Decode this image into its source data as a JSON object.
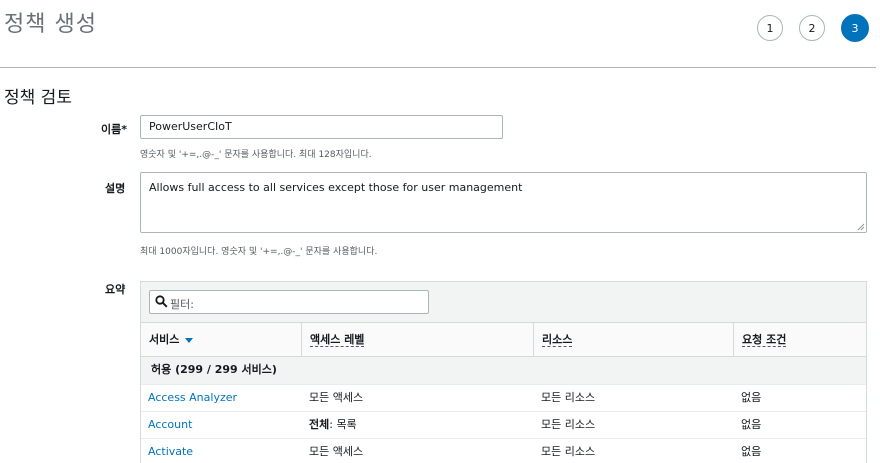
{
  "header": {
    "title": "정책 생성"
  },
  "wizard": {
    "steps": [
      "1",
      "2",
      "3"
    ],
    "current_step": 3
  },
  "section": {
    "title": "정책 검토"
  },
  "form": {
    "name": {
      "label": "이름*",
      "value": "PowerUserCIoT",
      "hint": "영숫자 및 '+=,.@-_' 문자를 사용합니다. 최대 128자입니다."
    },
    "description": {
      "label": "설명",
      "value": "Allows full access to all services except those for user management",
      "hint": "최대 1000자입니다. 영숫자 및 '+=,.@-_' 문자를 사용합니다."
    }
  },
  "summary": {
    "label": "요약",
    "filter_placeholder": "필터:",
    "columns": [
      "서비스",
      "액세스 레벨",
      "리소스",
      "요청 조건"
    ],
    "group": "허용 (299 / 299 서비스)",
    "rows": [
      {
        "service": "Access Analyzer",
        "access_prefix": "",
        "access": "모든 액세스",
        "resource": "모든 리소스",
        "condition": "없음"
      },
      {
        "service": "Account",
        "access_prefix": "전체",
        "access": ": 목록",
        "resource": "모든 리소스",
        "condition": "없음"
      },
      {
        "service": "Activate",
        "access_prefix": "",
        "access": "모든 액세스",
        "resource": "모든 리소스",
        "condition": "없음"
      }
    ]
  },
  "colors": {
    "accent": "#0073bb",
    "border": "#aab7b8",
    "header_bg": "#f2f3f3"
  },
  "icons": [
    "search-icon",
    "sort-down-icon",
    "resize-handle-icon"
  ]
}
